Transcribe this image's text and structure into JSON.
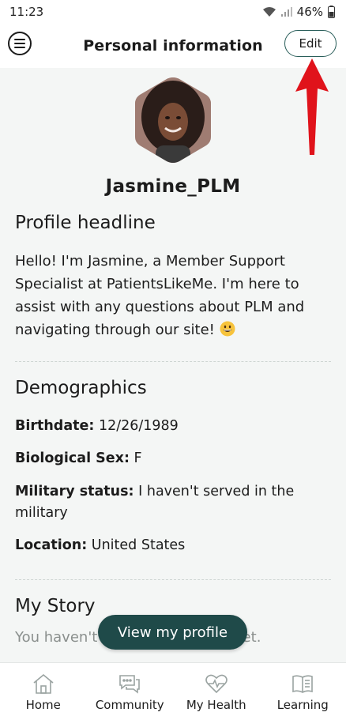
{
  "status_bar": {
    "time": "11:23",
    "battery": "46%"
  },
  "header": {
    "title": "Personal information",
    "edit_label": "Edit"
  },
  "profile": {
    "username": "Jasmine_PLM"
  },
  "headline_section": {
    "title": "Profile headline",
    "text": "Hello! I'm Jasmine, a Member Support Specialist at PatientsLikeMe. I'm here to assist with any questions about PLM and navigating through our site!"
  },
  "demographics": {
    "title": "Demographics",
    "birthdate_label": "Birthdate:",
    "birthdate_value": "12/26/1989",
    "sex_label": "Biological Sex:",
    "sex_value": "F",
    "military_label": "Military status:",
    "military_value": "I haven't served in the military",
    "location_label": "Location:",
    "location_value": "United States"
  },
  "story": {
    "title": "My Story",
    "text": "You haven't written your story yet."
  },
  "view_profile_label": "View my profile",
  "nav": [
    {
      "label": "Home",
      "icon": "home-icon"
    },
    {
      "label": "Community",
      "icon": "chat-icon"
    },
    {
      "label": "My Health",
      "icon": "heart-pulse-icon"
    },
    {
      "label": "Learning",
      "icon": "book-icon"
    }
  ],
  "colors": {
    "accent": "#1f4a49",
    "annotation_arrow": "#e0131b"
  }
}
